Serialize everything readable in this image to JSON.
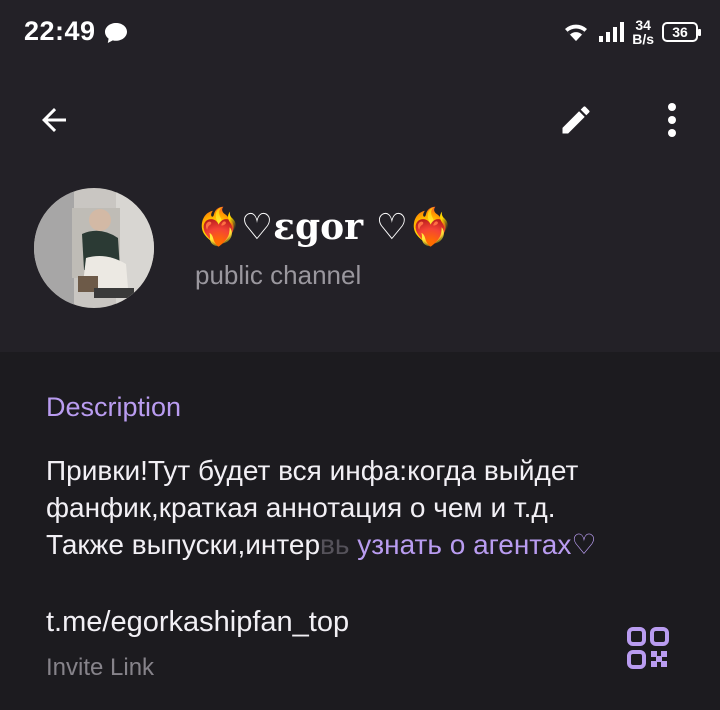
{
  "status_bar": {
    "time": "22:49",
    "message_icon": "chat-bubble-icon",
    "wifi_icon": "wifi-icon",
    "signal_icon": "signal-icon",
    "speed_value": "34",
    "speed_unit": "B/s",
    "battery": "36"
  },
  "toolbar": {
    "back_icon": "arrow-back-icon",
    "edit_icon": "pencil-icon",
    "more_icon": "more-vertical-icon"
  },
  "profile": {
    "title_prefix": "❤️‍🔥♡",
    "title_main": "ɛgor",
    "title_suffix": " ♡❤️‍🔥",
    "subtitle": "public channel"
  },
  "description": {
    "heading": "Description",
    "line1": "Привки!Тут будет вся инфа:когда выйдет",
    "line2": "фанфик,краткая аннотация о чем и т.д.",
    "line3_visible": "Также выпуски,интер",
    "line3_faded": "вь",
    "more_link": " узнать о агентах♡"
  },
  "invite": {
    "link": "t.me/egorkashipfan_top",
    "label": "Invite Link",
    "qr_icon": "qr-code-icon"
  },
  "colors": {
    "accent": "#b99cf0",
    "header_bg": "#232127",
    "page_bg": "#1c1b1f"
  }
}
